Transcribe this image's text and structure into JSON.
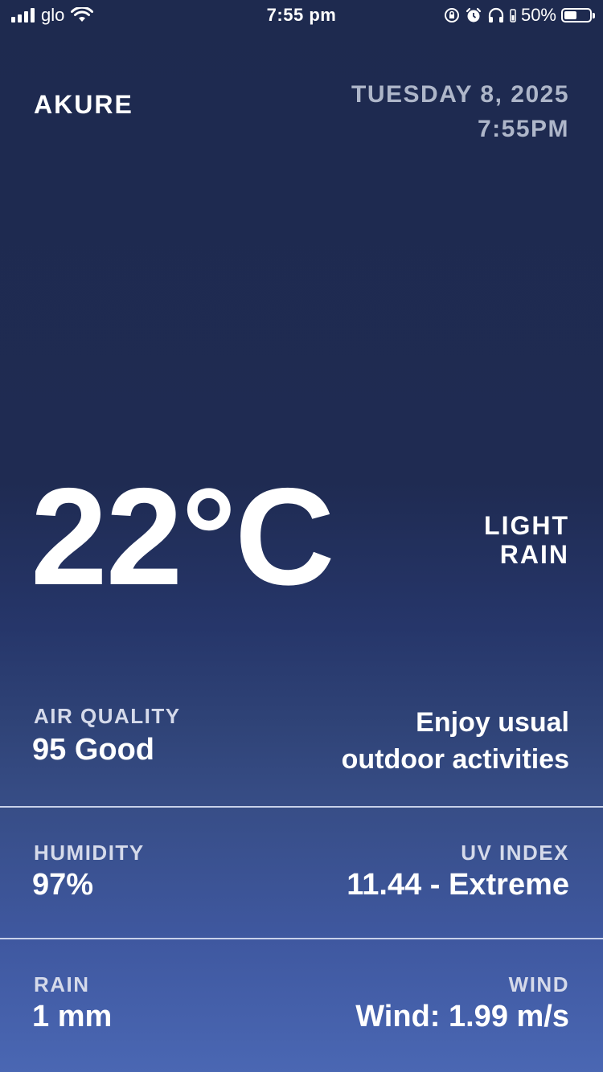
{
  "status_bar": {
    "carrier": "glo",
    "time": "7:55 pm",
    "battery_percent": "50%",
    "battery_level": 0.5,
    "icons": [
      "signal-icon",
      "wifi-icon",
      "orientation-lock-icon",
      "alarm-icon",
      "headphones-icon",
      "battery-icon"
    ]
  },
  "header": {
    "city": "AKURE",
    "date": "TUESDAY 8, 2025",
    "time": "7:55PM"
  },
  "current": {
    "temperature": "22°C",
    "condition_line1": "LIGHT",
    "condition_line2": "RAIN"
  },
  "air_quality": {
    "label": "AIR QUALITY",
    "value": "95 Good",
    "advice_line1": "Enjoy usual",
    "advice_line2": "outdoor activities"
  },
  "humidity": {
    "label": "HUMIDITY",
    "value": "97%"
  },
  "uv_index": {
    "label": "UV INDEX",
    "value": "11.44 - Extreme"
  },
  "rain": {
    "label": "RAIN",
    "value": "1 mm"
  },
  "wind": {
    "label": "WIND",
    "value": "Wind: 1.99 m/s"
  },
  "colors": {
    "background_top": "#1e2a4f",
    "background_bottom": "#4a67b3",
    "date_text": "#aeb6c9",
    "label_text": "#d5daea",
    "divider": "#c9d2ea"
  }
}
